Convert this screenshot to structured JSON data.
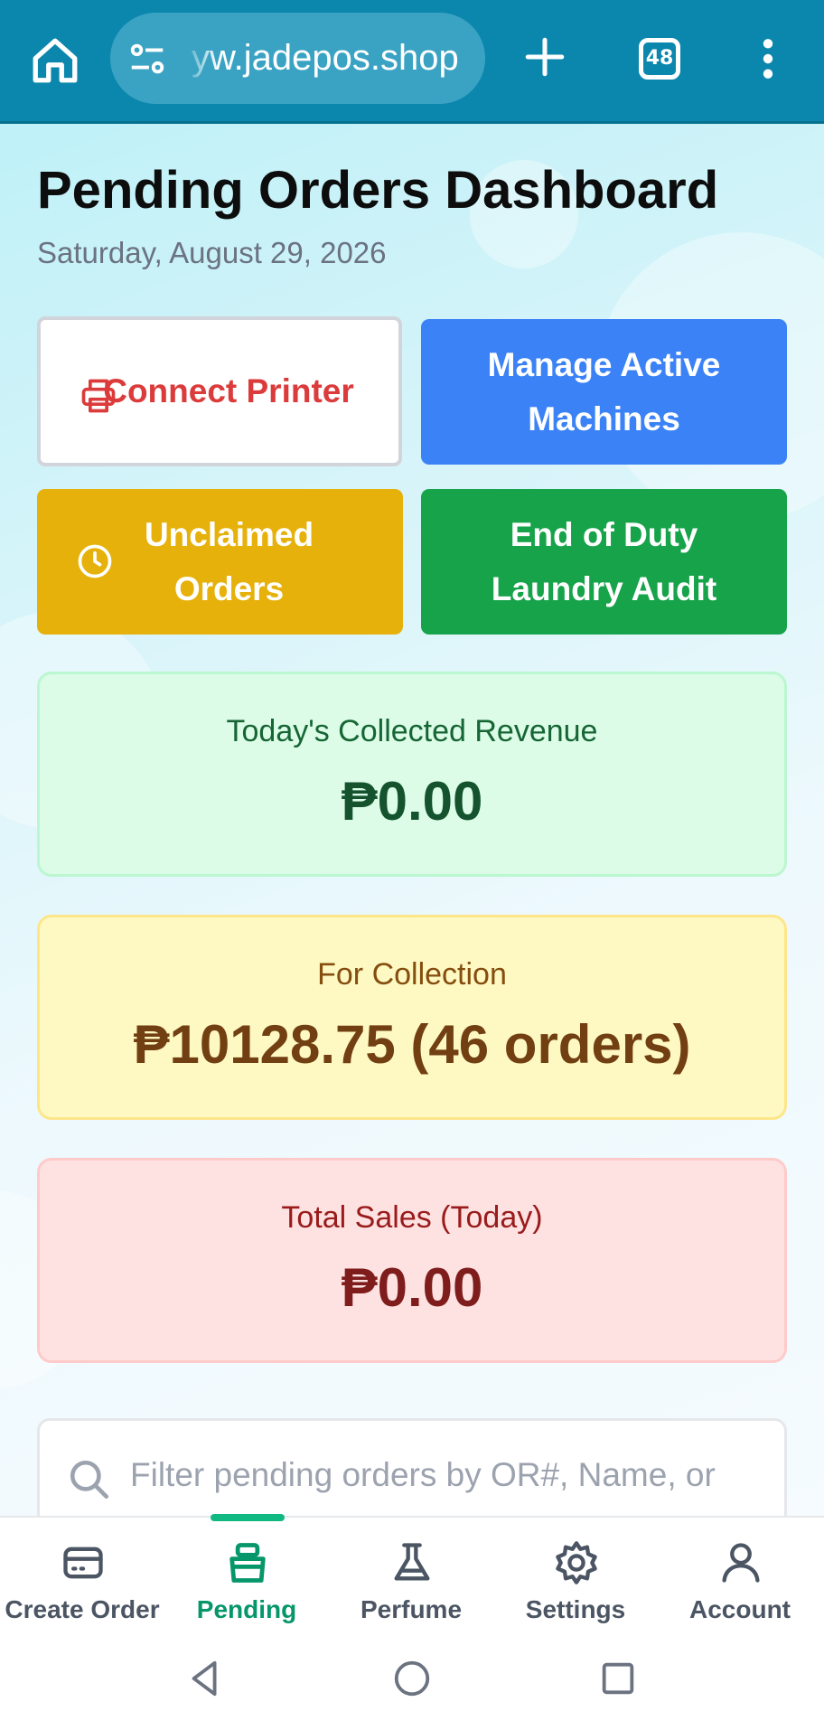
{
  "browser": {
    "url": "yw.jadepos.shop",
    "tab_count": "48"
  },
  "page": {
    "title": "Pending Orders Dashboard",
    "date": "Saturday, August 29, 2026"
  },
  "actions": {
    "connect_printer": "Connect Printer",
    "manage_machines": "Manage Active Machines",
    "unclaimed_orders": "Unclaimed Orders",
    "end_of_duty": "End of Duty Laundry Audit"
  },
  "stats": {
    "revenue": {
      "label": "Today's Collected Revenue",
      "value": "₱0.00"
    },
    "collection": {
      "label": "For Collection",
      "value": "₱10128.75 (46 orders)"
    },
    "sales": {
      "label": "Total Sales (Today)",
      "value": "₱0.00"
    }
  },
  "search": {
    "placeholder": "Filter pending orders by OR#, Name, or"
  },
  "bottom_nav": {
    "active": "Pending",
    "items": [
      {
        "label": "Create Order",
        "icon": "card-icon"
      },
      {
        "label": "Pending",
        "icon": "basket-icon"
      },
      {
        "label": "Perfume",
        "icon": "flask-icon"
      },
      {
        "label": "Settings",
        "icon": "gear-icon"
      },
      {
        "label": "Account",
        "icon": "user-icon"
      }
    ]
  },
  "colors": {
    "toolbar": "#0b87ad",
    "printer_text": "#dc3b3b",
    "machines": "#3b82f6",
    "unclaimed": "#e6b10b",
    "audit": "#16a34a",
    "nav_active": "#059669"
  }
}
